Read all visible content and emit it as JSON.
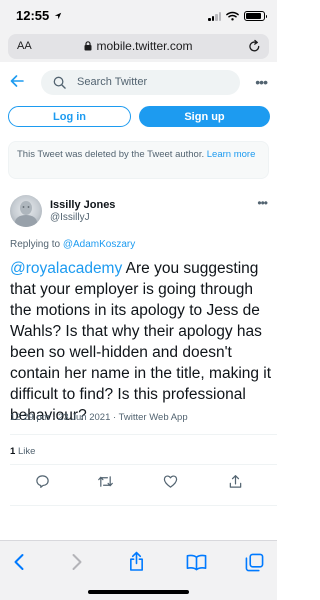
{
  "status_bar": {
    "time": "12:55",
    "battery_level": 0.9
  },
  "browser": {
    "text_size_label": "AA",
    "url": "mobile.twitter.com"
  },
  "search": {
    "placeholder": "Search Twitter"
  },
  "auth": {
    "login_label": "Log in",
    "signup_label": "Sign up"
  },
  "notice": {
    "text": "This Tweet was deleted by the Tweet author.",
    "link": "Learn more"
  },
  "tweet": {
    "author_name": "Issilly Jones",
    "author_handle": "@IssillyJ",
    "replying_prefix": "Replying to",
    "replying_to": "@AdamKoszary",
    "mention": "@royalacademy",
    "text": " Are you suggesting that your employer is going through the motions in its apology to Jess de Wahls? Is that why their apology has been so well-hidden and doesn't contain her name in the title, making it difficult to find? Is this professional behaviour?",
    "meta": "12:29 pm · 23 Jun 2021 · Twitter Web App",
    "like_count": "1",
    "like_label": "Like"
  },
  "icons": {
    "status": [
      "navigation-arrow-icon",
      "signal-icon",
      "wifi-icon",
      "battery-icon"
    ],
    "browser": [
      "lock-icon",
      "reload-icon"
    ],
    "nav": [
      "back-arrow-icon",
      "search-icon",
      "more-icon"
    ],
    "tweet_actions": [
      "reply-icon",
      "retweet-icon",
      "like-icon",
      "share-icon"
    ],
    "toolbar": [
      "back-icon",
      "forward-icon",
      "share-icon",
      "bookmarks-icon",
      "tabs-icon"
    ]
  },
  "colors": {
    "accent": "#1d9bf0",
    "text": "#0f1419",
    "muted": "#536471"
  }
}
